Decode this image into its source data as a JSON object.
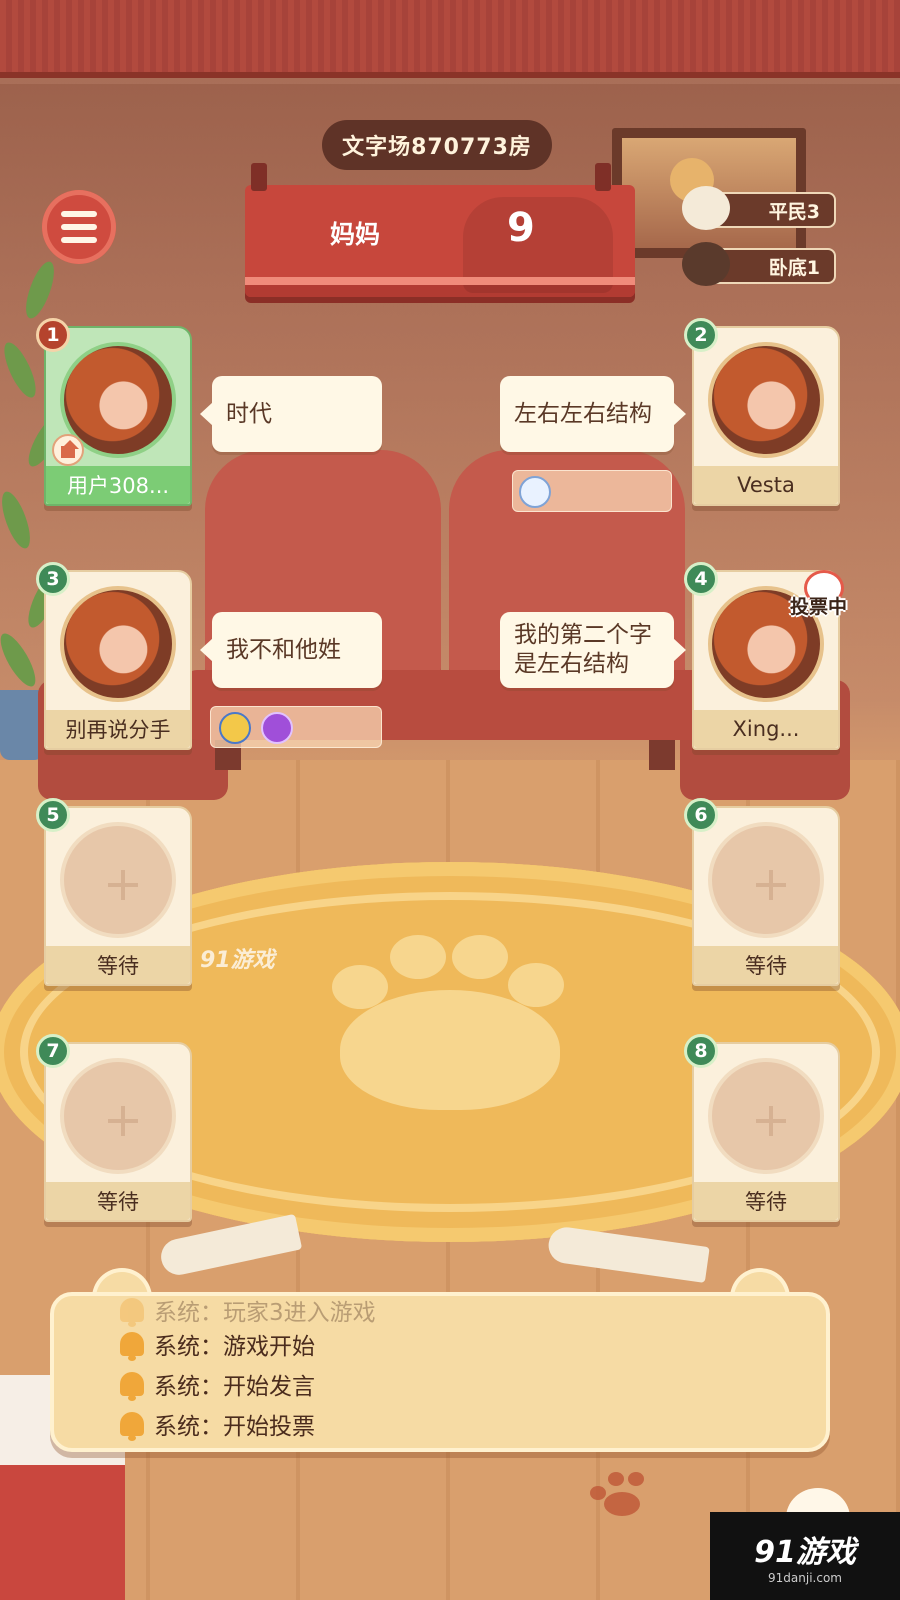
{
  "room": {
    "title": "文字场870773房"
  },
  "word_sign": {
    "word": "妈妈",
    "count": "9"
  },
  "roles": [
    {
      "label": "平民3"
    },
    {
      "label": "卧底1"
    }
  ],
  "seats": [
    {
      "number": "1",
      "name": "用户308...",
      "occupied": true,
      "self": true,
      "speech": "时代"
    },
    {
      "number": "2",
      "name": "Vesta",
      "occupied": true,
      "self": false,
      "speech": "左右左右结构"
    },
    {
      "number": "3",
      "name": "别再说分手",
      "occupied": true,
      "self": false,
      "speech": "我不和他姓"
    },
    {
      "number": "4",
      "name": "Xing...",
      "occupied": true,
      "self": false,
      "speech": "我的第二个字是左右结构",
      "status": "投票中"
    },
    {
      "number": "5",
      "name": "等待",
      "occupied": false
    },
    {
      "number": "6",
      "name": "等待",
      "occupied": false
    },
    {
      "number": "7",
      "name": "等待",
      "occupied": false
    },
    {
      "number": "8",
      "name": "等待",
      "occupied": false
    }
  ],
  "speech_lines": {
    "seat4_line1": "我的第二个字",
    "seat4_line2": "是左右结构"
  },
  "log": [
    {
      "text": "系统：玩家3进入游戏"
    },
    {
      "text": "系统：游戏开始"
    },
    {
      "text": "系统：开始发言"
    },
    {
      "text": "系统：开始投票"
    }
  ],
  "watermark": {
    "mid": "91游戏",
    "corner": "91游戏",
    "corner_url": "91danji.com"
  },
  "colors": {
    "accent": "#c7473c",
    "seat_badge": "#3f8a58",
    "self_card": "#bfe6b8"
  },
  "icons": [
    "menu-icon",
    "home-icon",
    "bell-icon",
    "chat-icon",
    "plus-icon",
    "paw-icon",
    "cat-icon"
  ]
}
